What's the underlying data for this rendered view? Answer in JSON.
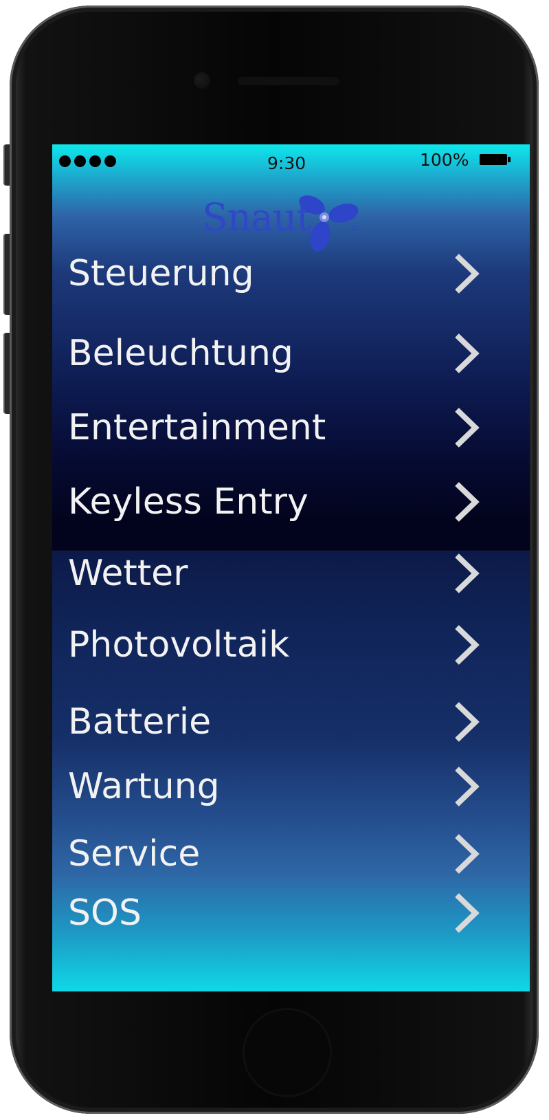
{
  "status_bar": {
    "time": "9:30",
    "battery_percent": "100%",
    "signal_bars": 4
  },
  "logo": {
    "text": "Snaut",
    "icon": "propeller-icon"
  },
  "menu": {
    "items": [
      {
        "label": "Steuerung"
      },
      {
        "label": "Beleuchtung"
      },
      {
        "label": "Entertainment"
      },
      {
        "label": "Keyless Entry"
      },
      {
        "label": "Wetter"
      },
      {
        "label": "Photovoltaik"
      },
      {
        "label": "Batterie"
      },
      {
        "label": "Wartung"
      },
      {
        "label": "Service"
      },
      {
        "label": "SOS"
      }
    ],
    "chevron_icon": "chevron-right-icon"
  },
  "colors": {
    "screen_top": "#0de8ec",
    "screen_mid": "#02031c",
    "screen_bottom": "#0fd8e6",
    "menu_text": "#f2f2f2",
    "logo_blue": "#3047c7"
  }
}
